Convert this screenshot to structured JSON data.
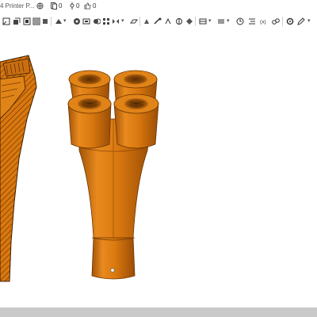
{
  "header": {
    "title_fragment": "4 Printer P...",
    "branches_count": "0",
    "versions_count": "0",
    "likes_count": "0"
  },
  "toolbar": {
    "icons": [
      "sketch-icon",
      "extrude-icon",
      "revolve-icon",
      "sweep-icon",
      "fillet-icon",
      "chamfer-icon",
      "hole-icon",
      "shell-icon",
      "boolean-icon",
      "pattern-icon",
      "mirror-icon",
      "plane-icon",
      "assembly-icon",
      "measure-icon",
      "section-icon",
      "render-icon",
      "appearance-icon",
      "mate-icon",
      "explode-icon",
      "variable-icon",
      "settings-icon"
    ]
  },
  "viewport": {
    "body_color": "#d9780f",
    "model": "four-channel-nozzle-manifold"
  }
}
